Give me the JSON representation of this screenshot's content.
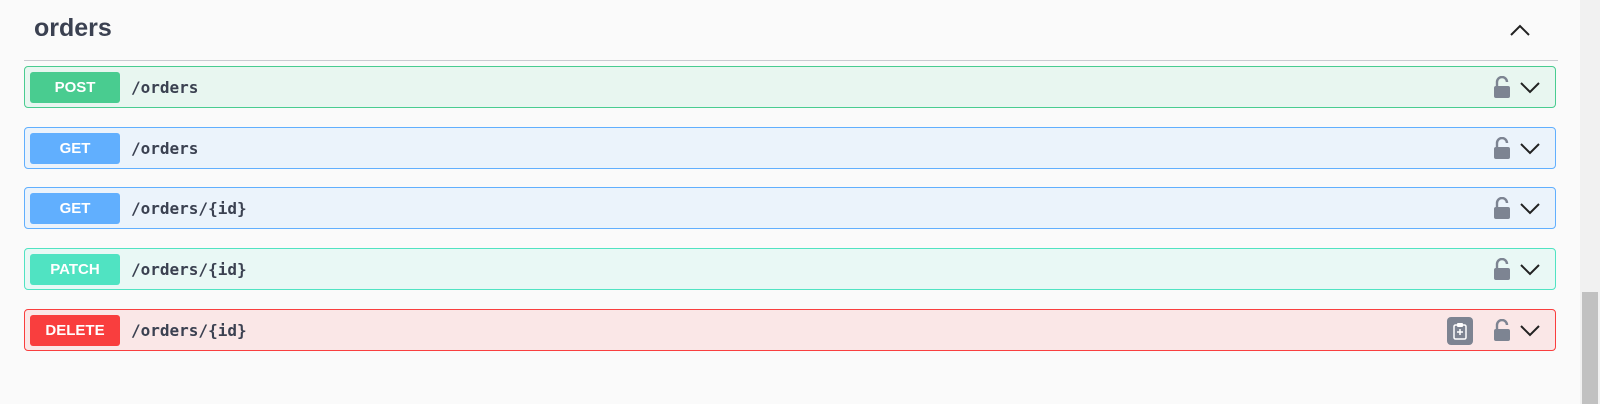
{
  "section": {
    "title": "orders"
  },
  "operations": [
    {
      "method": "POST",
      "path": "/orders",
      "color": "#49cc90"
    },
    {
      "method": "GET",
      "path": "/orders",
      "color": "#61affe"
    },
    {
      "method": "GET",
      "path": "/orders/{id}",
      "color": "#61affe"
    },
    {
      "method": "PATCH",
      "path": "/orders/{id}",
      "color": "#50e3c2"
    },
    {
      "method": "DELETE",
      "path": "/orders/{id}",
      "color": "#f93e3e"
    }
  ],
  "icons": {
    "collapse": "chevron-up-icon",
    "lock": "unlocked-padlock-icon",
    "expand": "chevron-down-icon",
    "copy": "clipboard-copy-icon"
  }
}
